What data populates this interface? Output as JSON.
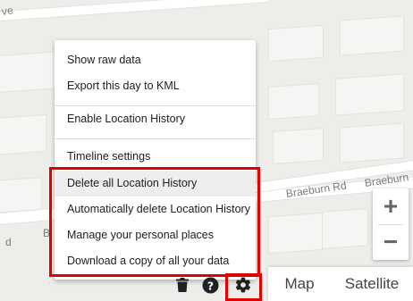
{
  "map": {
    "streets": [
      {
        "label": "ve"
      },
      {
        "label": "Braeburn Rd"
      },
      {
        "label": "Braeburn"
      },
      {
        "label": "d"
      },
      {
        "label": "B"
      }
    ]
  },
  "menu": {
    "items": [
      {
        "label": "Show raw data"
      },
      {
        "label": "Export this day to KML"
      },
      {
        "label": "Enable Location History"
      },
      {
        "label": "Timeline settings"
      },
      {
        "label": "Delete all Location History"
      },
      {
        "label": "Automatically delete Location History"
      },
      {
        "label": "Manage your personal places"
      },
      {
        "label": "Download a copy of all your data"
      }
    ]
  },
  "zoom": {
    "in_label": "+",
    "out_label": "−"
  },
  "map_type": {
    "map_label": "Map",
    "satellite_label": "Satellite"
  },
  "toolbar": {
    "icons": [
      "trash-icon",
      "help-icon",
      "gear-icon"
    ]
  },
  "colors": {
    "highlight": "#e00000",
    "menu_hover": "#eeeeee"
  }
}
